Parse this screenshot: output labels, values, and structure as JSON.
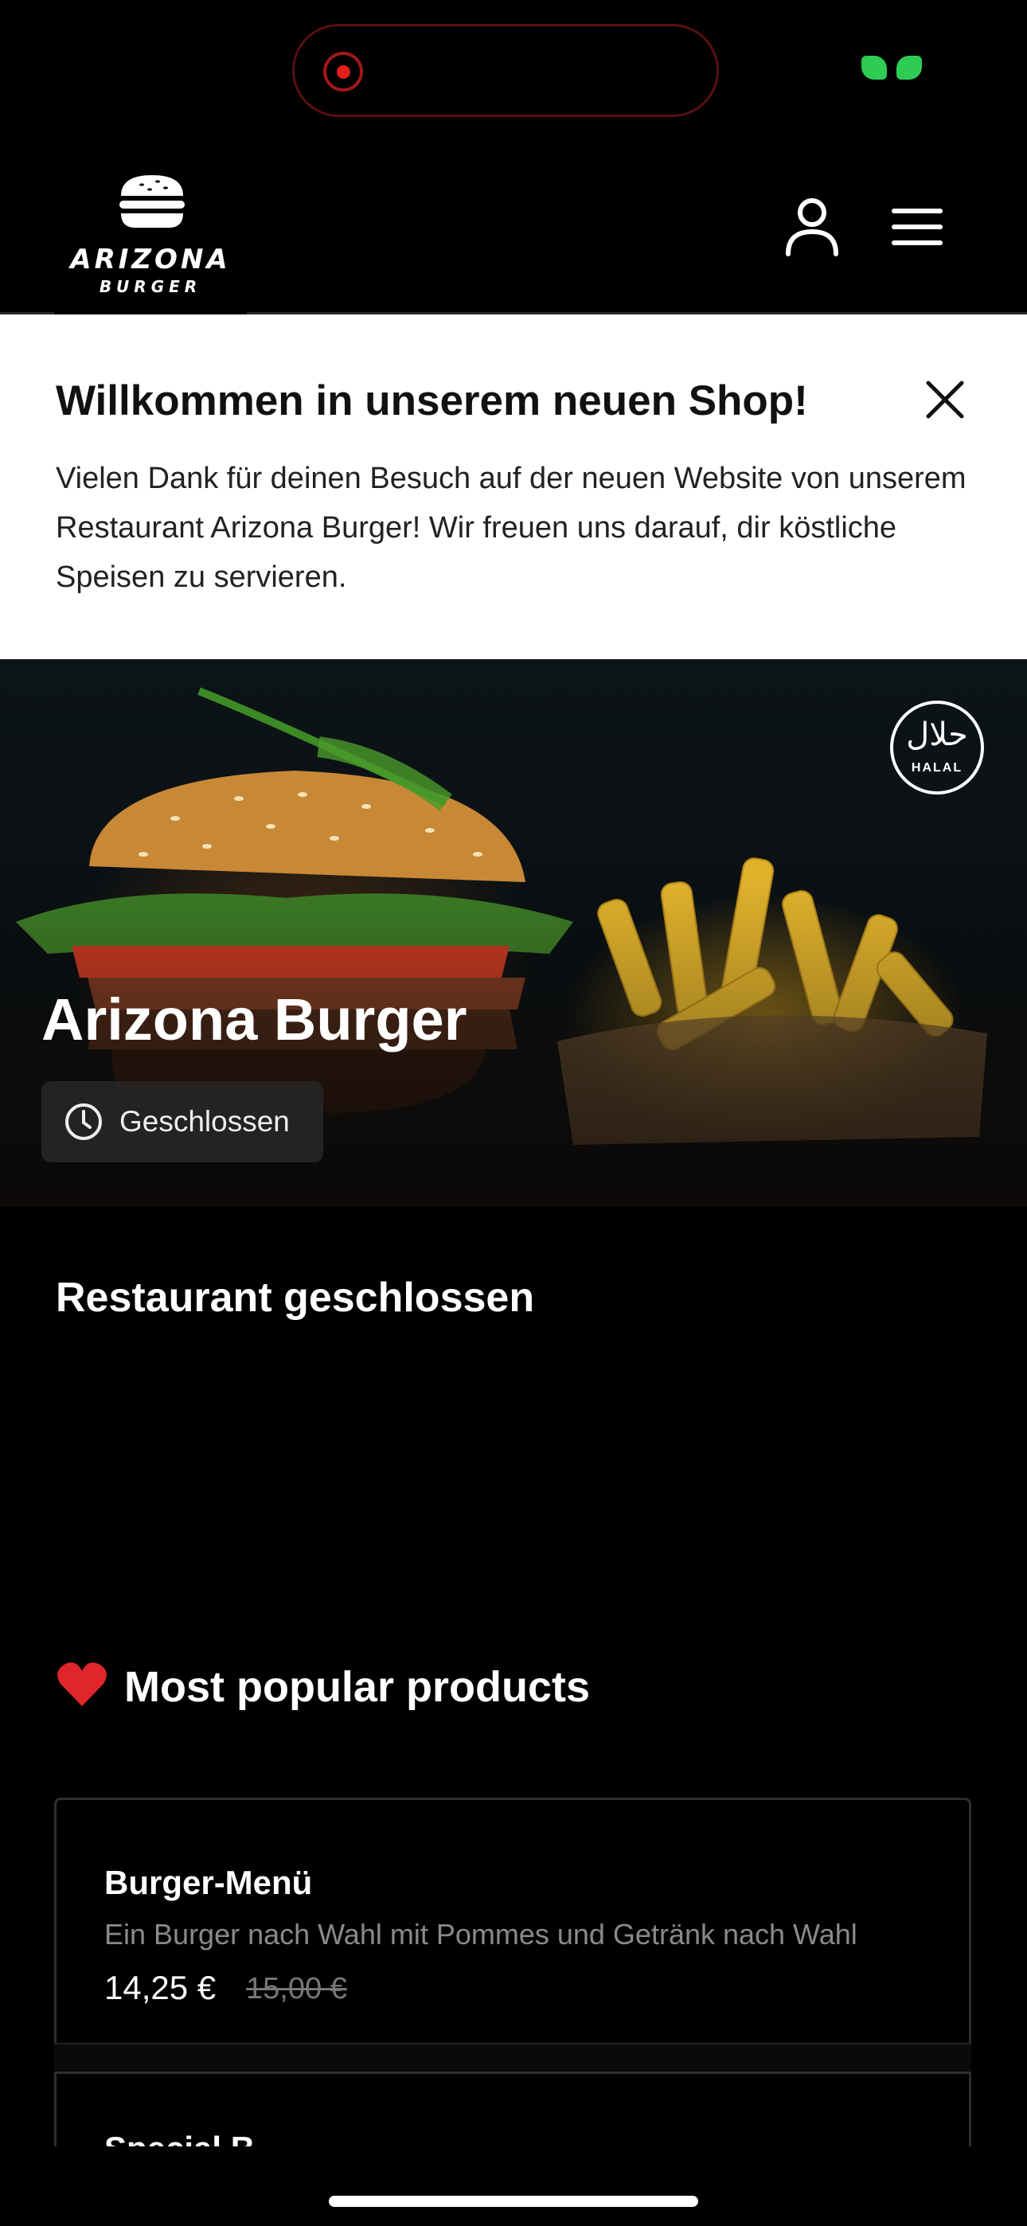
{
  "header": {
    "logo_name": "ARIZONA",
    "logo_sub": "BURGER"
  },
  "banner": {
    "title": "Willkommen in unserem neuen Shop!",
    "text": "Vielen Dank für deinen Besuch auf der neuen Website von unserem Restaurant Arizona Burger! Wir freuen uns darauf, dir köstliche Speisen zu servieren."
  },
  "hero": {
    "title": "Arizona Burger",
    "status": "Geschlossen",
    "badge_ar": "حلال",
    "badge_en": "HALAL"
  },
  "closed_notice": "Restaurant geschlossen",
  "popular": {
    "title": "Most popular products",
    "products": [
      {
        "name": "Burger-Menü",
        "description": "Ein Burger nach Wahl mit Pommes und Getränk nach Wahl",
        "price": "14,25 €",
        "old_price": "15,00 €"
      },
      {
        "name": "Special B..."
      }
    ]
  },
  "icons": {
    "user": "user-icon",
    "menu": "hamburger-menu-icon",
    "close": "close-icon",
    "clock": "clock-icon",
    "heart": "heart-icon"
  },
  "colors": {
    "background": "#000000",
    "banner": "#ffffff",
    "heart": "#e0262b",
    "recording": "#e11d1d",
    "camera_indicator": "#2ecc55"
  }
}
